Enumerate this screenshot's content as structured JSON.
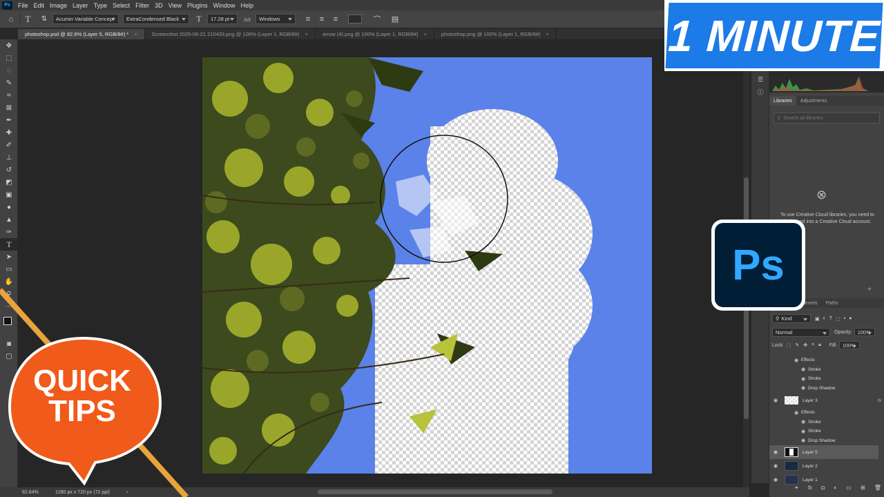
{
  "app": {
    "logo_text": "Ps"
  },
  "menu": [
    "File",
    "Edit",
    "Image",
    "Layer",
    "Type",
    "Select",
    "Filter",
    "3D",
    "View",
    "Plugins",
    "Window",
    "Help"
  ],
  "options": {
    "font_family": "Acumin Variable Concept",
    "font_style": "ExtraCondensed Black",
    "font_size": "17.28 pt",
    "antialias": "Windows"
  },
  "tabs": [
    {
      "label": "photoshop.psd @ 82.6% (Layer 5, RGB/8#) *",
      "active": true
    },
    {
      "label": "Screenshot 2025-06-21 210433.png @ 100% (Layer 1, RGB/8#)",
      "active": false
    },
    {
      "label": "arrow (4).png @ 100% (Layer 1, RGB/8#)",
      "active": false
    },
    {
      "label": "photoshop.png @ 100% (Layer 1, RGB/8#)",
      "active": false
    }
  ],
  "status": {
    "zoom": "82.64%",
    "doc_info": "1280 px x 720 px (72 ppi)"
  },
  "libraries": {
    "tab_libraries": "Libraries",
    "tab_adjustments": "Adjustments",
    "search_placeholder": "Search all libraries",
    "message": "To use Creative Cloud libraries, you need to be logged into a Creative Cloud account."
  },
  "layers_panel": {
    "tab_channels": "Channels",
    "tab_paths": "Paths",
    "filter_kind": "Kind",
    "blend_mode": "Normal",
    "opacity_label": "Opacity:",
    "opacity_value": "100%",
    "lock_label": "Lock:",
    "fill_label": "Fill:",
    "fill_value": "100%",
    "rows": [
      {
        "label": "Effects",
        "indent": 2,
        "type": "effects"
      },
      {
        "label": "Stroke",
        "indent": 3,
        "type": "effect"
      },
      {
        "label": "Stroke",
        "indent": 3,
        "type": "effect"
      },
      {
        "label": "Drop Shadow",
        "indent": 3,
        "type": "effect"
      },
      {
        "label": "Layer 3",
        "indent": 0,
        "type": "layer",
        "fx": "fx"
      },
      {
        "label": "Effects",
        "indent": 2,
        "type": "effects"
      },
      {
        "label": "Stroke",
        "indent": 3,
        "type": "effect"
      },
      {
        "label": "Stroke",
        "indent": 3,
        "type": "effect"
      },
      {
        "label": "Drop Shadow",
        "indent": 3,
        "type": "effect"
      },
      {
        "label": "Layer 5",
        "indent": 0,
        "type": "layer",
        "selected": true
      },
      {
        "label": "Layer 2",
        "indent": 0,
        "type": "layer"
      },
      {
        "label": "Layer 1",
        "indent": 0,
        "type": "layer"
      }
    ]
  },
  "overlay": {
    "minute_badge": "1 MINUTE",
    "quick_tips": [
      "QUICK",
      "TIPS"
    ],
    "ps_logo": "Ps"
  },
  "colors": {
    "accent_blue": "#1c7be6",
    "quick_tips_orange": "#f05a1a",
    "sky_blue": "#5b82e8",
    "ps_dark": "#001e36",
    "ps_light": "#31a8ff"
  }
}
